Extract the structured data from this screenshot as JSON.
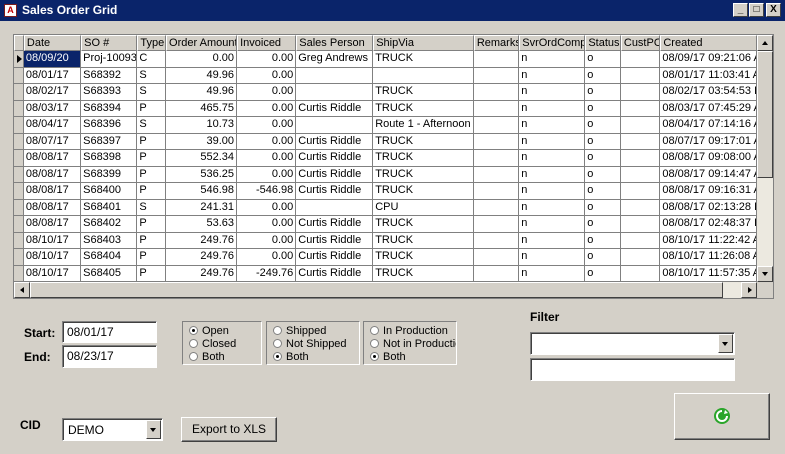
{
  "window": {
    "title": "Sales Order Grid",
    "icon": "app-logo-icon",
    "min_label": "_",
    "max_label": "□",
    "close_label": "X"
  },
  "grid": {
    "columns": [
      "Date",
      "SO #",
      "Type",
      "Order Amount",
      "Invoiced",
      "Sales Person",
      "ShipVia",
      "Remarks",
      "SvrOrdComp",
      "Status",
      "CustPO",
      "Created"
    ],
    "rows": [
      [
        "08/09/20",
        "Proj-10093",
        "C",
        "0.00",
        "0.00",
        "Greg Andrews",
        "TRUCK",
        "",
        "n",
        "o",
        "",
        "08/09/17 09:21:06 A"
      ],
      [
        "08/01/17",
        "S68392",
        "S",
        "49.96",
        "0.00",
        "",
        "",
        "",
        "n",
        "o",
        "",
        "08/01/17 11:03:41 A"
      ],
      [
        "08/02/17",
        "S68393",
        "S",
        "49.96",
        "0.00",
        "",
        "TRUCK",
        "",
        "n",
        "o",
        "",
        "08/02/17 03:54:53 P"
      ],
      [
        "08/03/17",
        "S68394",
        "P",
        "465.75",
        "0.00",
        "Curtis Riddle",
        "TRUCK",
        "",
        "n",
        "o",
        "",
        "08/03/17 07:45:29 A"
      ],
      [
        "08/04/17",
        "S68396",
        "S",
        "10.73",
        "0.00",
        "",
        "Route 1 - Afternoon",
        "",
        "n",
        "o",
        "",
        "08/04/17 07:14:16 A"
      ],
      [
        "08/07/17",
        "S68397",
        "P",
        "39.00",
        "0.00",
        "Curtis Riddle",
        "TRUCK",
        "",
        "n",
        "o",
        "",
        "08/07/17 09:17:01 A"
      ],
      [
        "08/08/17",
        "S68398",
        "P",
        "552.34",
        "0.00",
        "Curtis Riddle",
        "TRUCK",
        "",
        "n",
        "o",
        "",
        "08/08/17 09:08:00 A"
      ],
      [
        "08/08/17",
        "S68399",
        "P",
        "536.25",
        "0.00",
        "Curtis Riddle",
        "TRUCK",
        "",
        "n",
        "o",
        "",
        "08/08/17 09:14:47 A"
      ],
      [
        "08/08/17",
        "S68400",
        "P",
        "546.98",
        "-546.98",
        "Curtis Riddle",
        "TRUCK",
        "",
        "n",
        "o",
        "",
        "08/08/17 09:16:31 A"
      ],
      [
        "08/08/17",
        "S68401",
        "S",
        "241.31",
        "0.00",
        "",
        "CPU",
        "",
        "n",
        "o",
        "",
        "08/08/17 02:13:28 P"
      ],
      [
        "08/08/17",
        "S68402",
        "P",
        "53.63",
        "0.00",
        "Curtis Riddle",
        "TRUCK",
        "",
        "n",
        "o",
        "",
        "08/08/17 02:48:37 P"
      ],
      [
        "08/10/17",
        "S68403",
        "P",
        "249.76",
        "0.00",
        "Curtis Riddle",
        "TRUCK",
        "",
        "n",
        "o",
        "",
        "08/10/17 11:22:42 A"
      ],
      [
        "08/10/17",
        "S68404",
        "P",
        "249.76",
        "0.00",
        "Curtis Riddle",
        "TRUCK",
        "",
        "n",
        "o",
        "",
        "08/10/17 11:26:08 A"
      ],
      [
        "08/10/17",
        "S68405",
        "P",
        "249.76",
        "-249.76",
        "Curtis Riddle",
        "TRUCK",
        "",
        "n",
        "o",
        "",
        "08/10/17 11:57:35 A"
      ]
    ]
  },
  "dates": {
    "start_label": "Start:",
    "start_value": "08/01/17",
    "end_label": "End:",
    "end_value": "08/23/17"
  },
  "order_status": {
    "options": [
      "Open",
      "Closed",
      "Both"
    ],
    "selected": "Open"
  },
  "ship_status": {
    "options": [
      "Shipped",
      "Not Shipped",
      "Both"
    ],
    "selected": "Both"
  },
  "production_status": {
    "options": [
      "In Production",
      "Not in Production",
      "Both"
    ],
    "selected": "Both"
  },
  "filter": {
    "label": "Filter",
    "selected": "",
    "text": ""
  },
  "cid": {
    "label": "CID",
    "value": "DEMO"
  },
  "export": {
    "label": "Export to XLS"
  },
  "refresh": {
    "icon": "refresh-icon",
    "color": "#2aa52a"
  }
}
